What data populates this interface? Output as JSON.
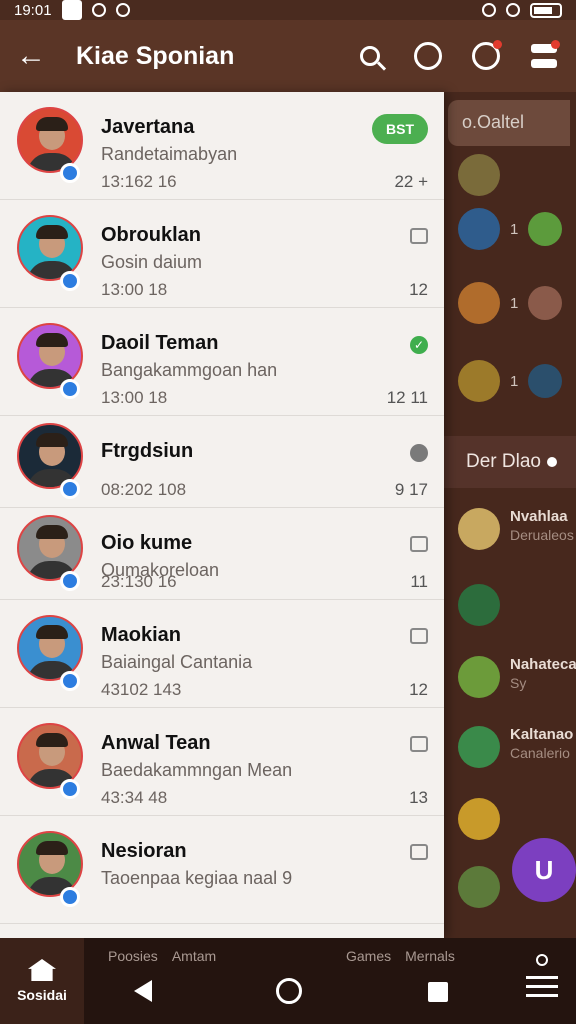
{
  "status_bar": {
    "time": "19:01"
  },
  "app_bar": {
    "title": "Kiae Sponian"
  },
  "contacts": [
    {
      "name": "Javertana",
      "preview": "Randetaimabyan",
      "time": "13:162 16",
      "count": "22 +",
      "avatar_color": "#d94a34",
      "pill": "BST"
    },
    {
      "name": "Obrouklan",
      "preview": "Gosin daium",
      "time": "13:00 18",
      "count": "12",
      "avatar_color": "#25b3c5"
    },
    {
      "name": "Daoil Teman",
      "preview": "Bangakammgoan han",
      "time": "13:00 18",
      "count": "12 11",
      "avatar_color": "#b65ad8"
    },
    {
      "name": "Ftrgdsiun",
      "preview": "",
      "time": "08:202 108",
      "count": "9 17",
      "avatar_color": "#1b2a38"
    },
    {
      "name": "Oio kume",
      "preview": "Oumakoreloan",
      "time": "23:130 16",
      "count": "11",
      "avatar_color": "#8b8b8b"
    },
    {
      "name": "Maokian",
      "preview": "Baiaingal Cantania",
      "time": "43102 143",
      "count": "12",
      "avatar_color": "#3a8fd0"
    },
    {
      "name": "Anwal Tean",
      "preview": "Baedakammngan Mean",
      "time": "43:34 48",
      "count": "13",
      "avatar_color": "#c96a4c"
    },
    {
      "name": "Nesioran",
      "preview": "Taoenpaa kegiaa naal 9",
      "time": "",
      "count": "",
      "avatar_color": "#4c8a46"
    }
  ],
  "background_panel": {
    "search_label": "o.Oaltel",
    "section_label": "Der Dlao",
    "items": [
      {
        "name": "Nvahlaa",
        "sub": "Derualeos"
      },
      {
        "name": "Nahateca",
        "sub": "Sy"
      },
      {
        "name": "Kaltanao",
        "sub": "Canalerio"
      }
    ],
    "fab_label": "U"
  },
  "bottom_nav": {
    "home_label": "Sosidai",
    "tabs": [
      "Poosies",
      "Amtam",
      "Games",
      "Mernals"
    ]
  }
}
